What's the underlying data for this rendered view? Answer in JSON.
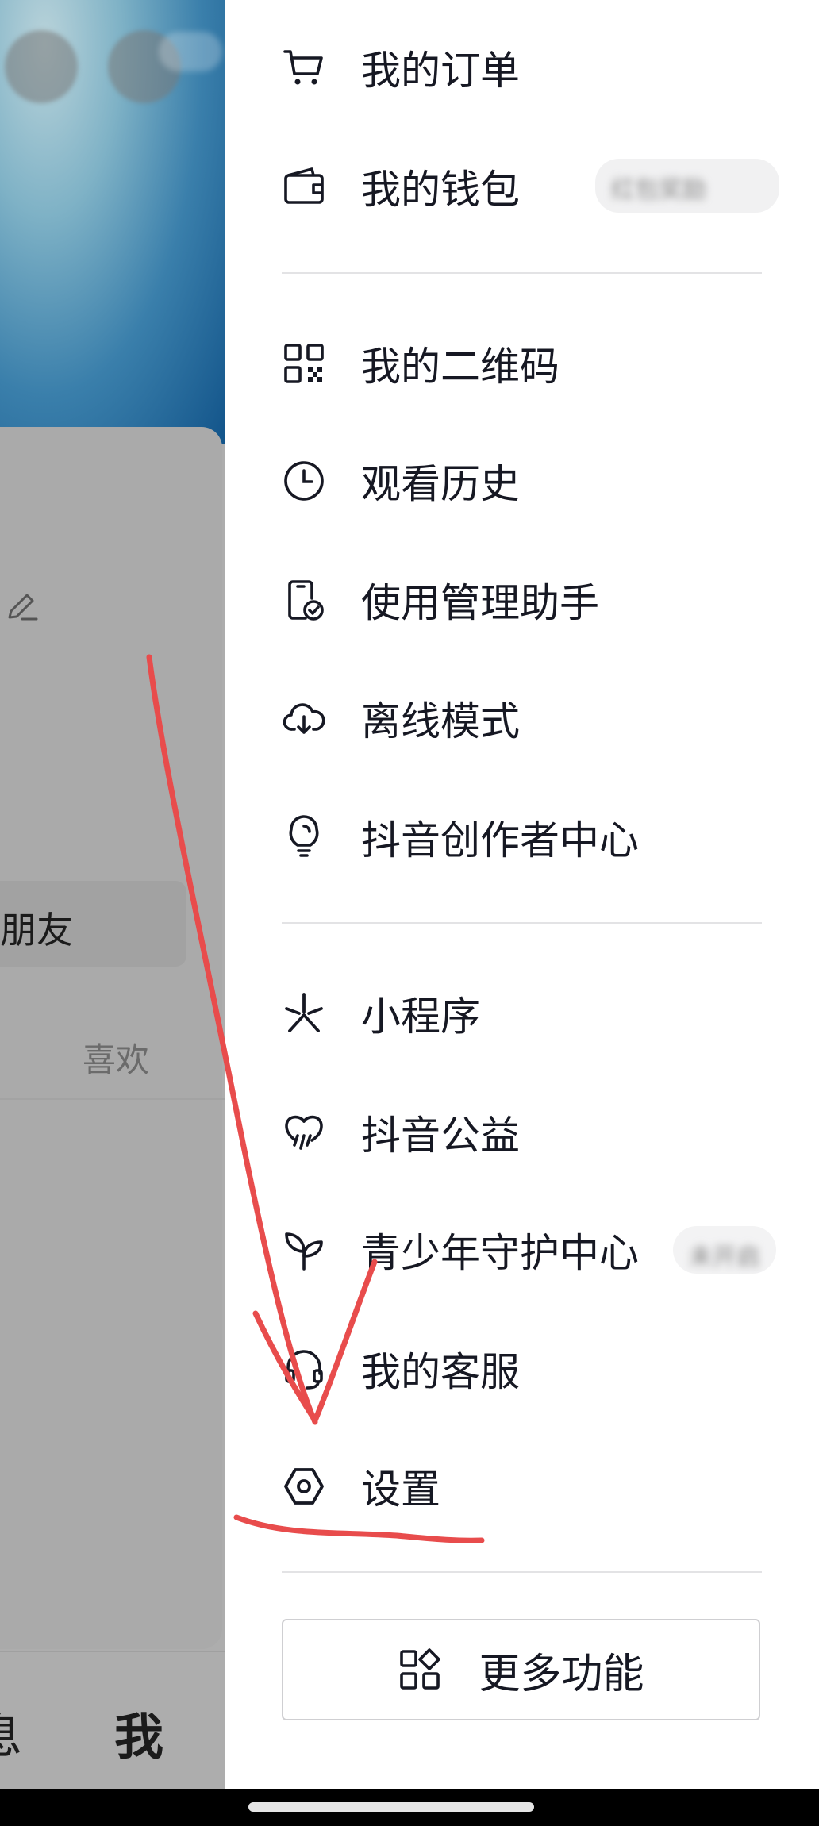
{
  "drawer": {
    "group1": [
      {
        "label": "我的订单",
        "icon": "cart-icon"
      },
      {
        "label": "我的钱包",
        "icon": "wallet-icon",
        "badge": "红包奖励"
      }
    ],
    "group2": [
      {
        "label": "我的二维码",
        "icon": "qr-code-icon"
      },
      {
        "label": "观看历史",
        "icon": "clock-icon"
      },
      {
        "label": "使用管理助手",
        "icon": "phone-check-icon"
      },
      {
        "label": "离线模式",
        "icon": "cloud-download-icon"
      },
      {
        "label": "抖音创作者中心",
        "icon": "lightbulb-icon"
      }
    ],
    "group3": [
      {
        "label": "小程序",
        "icon": "asterisk-icon"
      },
      {
        "label": "抖音公益",
        "icon": "heart-rain-icon"
      },
      {
        "label": "青少年守护中心",
        "icon": "sprout-icon",
        "badge": "未开启"
      },
      {
        "label": "我的客服",
        "icon": "headset-icon"
      },
      {
        "label": "设置",
        "icon": "settings-hexagon-icon"
      }
    ],
    "more": {
      "label": "更多功能",
      "icon": "grid-icon"
    }
  },
  "background": {
    "friend_button": "朋友",
    "tab_like": "喜欢",
    "nav_message": "息",
    "nav_me": "我"
  },
  "colors": {
    "text": "#161823",
    "divider": "#e3e3e5",
    "overlay": "#adadad",
    "annotation": "#e84c4c"
  }
}
